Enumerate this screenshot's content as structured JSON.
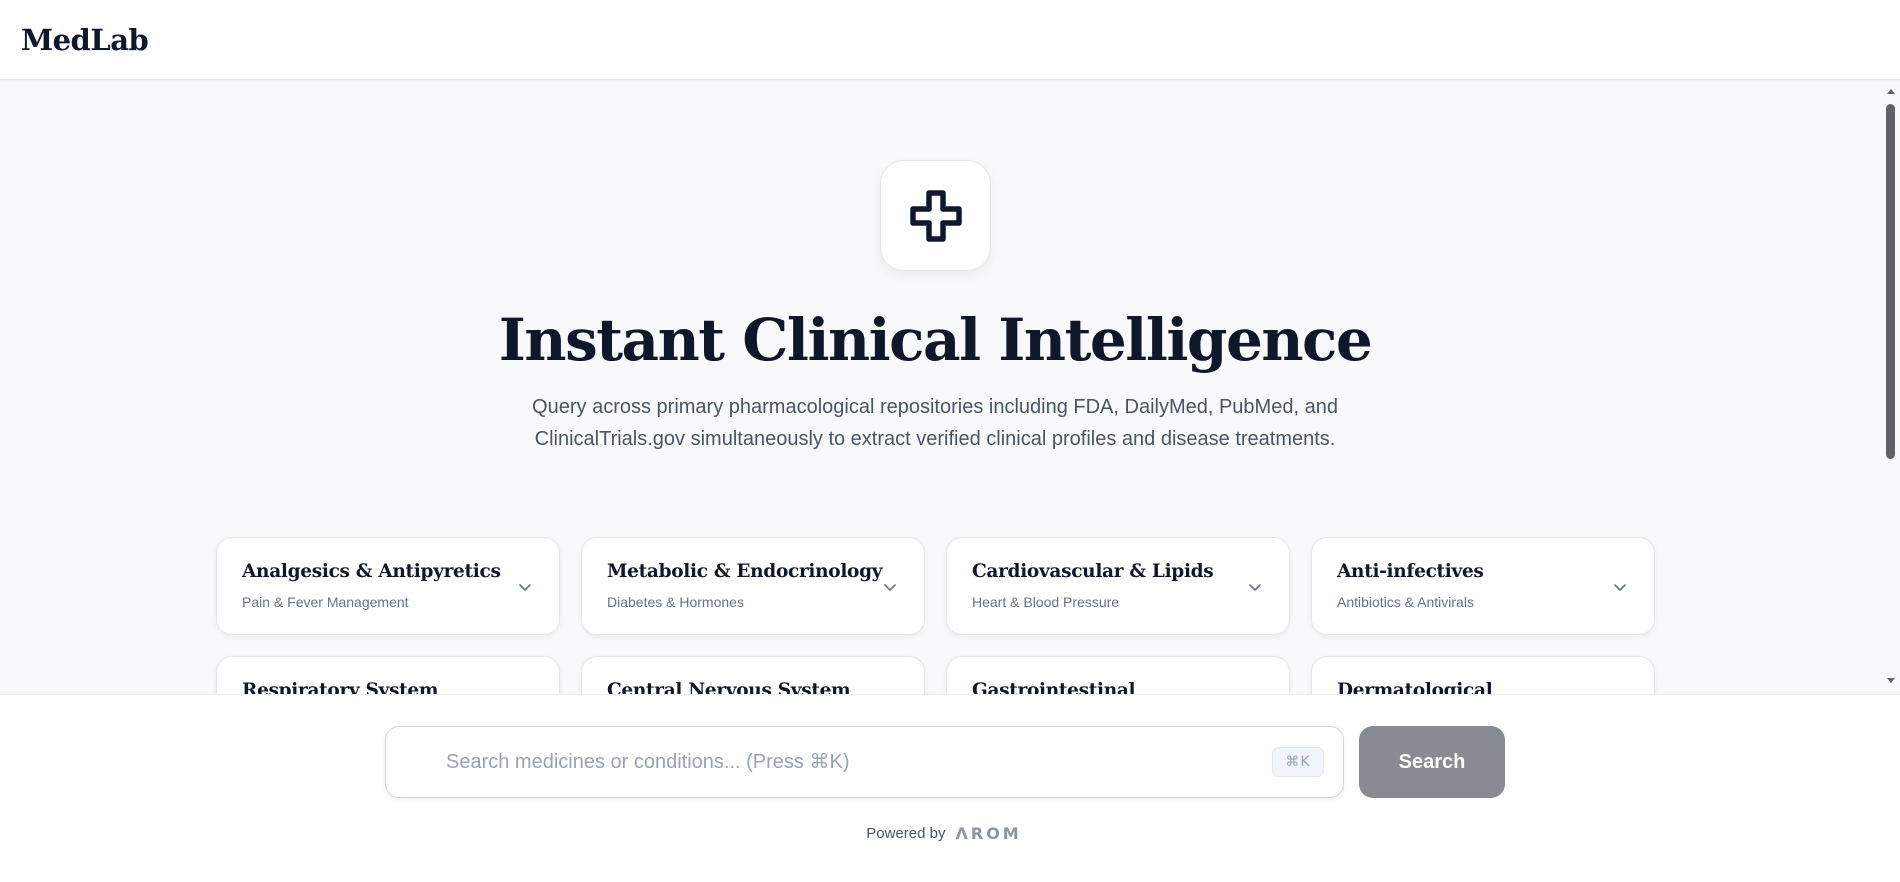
{
  "header": {
    "brand": "MedLab"
  },
  "hero": {
    "icon": "medical-cross-icon",
    "title": "Instant Clinical Intelligence",
    "subtitle_line1": "Query across primary pharmacological repositories including FDA, DailyMed, PubMed, and",
    "subtitle_line2": "ClinicalTrials.gov simultaneously to extract verified clinical profiles and disease treatments."
  },
  "categories": [
    {
      "title": "Analgesics & Antipyretics",
      "subtitle": "Pain & Fever Management"
    },
    {
      "title": "Metabolic & Endocrinology",
      "subtitle": "Diabetes & Hormones"
    },
    {
      "title": "Cardiovascular & Lipids",
      "subtitle": "Heart & Blood Pressure"
    },
    {
      "title": "Anti-infectives",
      "subtitle": "Antibiotics & Antivirals"
    },
    {
      "title": "Respiratory System",
      "subtitle": ""
    },
    {
      "title": "Central Nervous System",
      "subtitle": ""
    },
    {
      "title": "Gastrointestinal",
      "subtitle": ""
    },
    {
      "title": "Dermatological",
      "subtitle": ""
    }
  ],
  "search": {
    "placeholder": "Search medicines or conditions... (Press ⌘K)",
    "value": "",
    "shortcut_hint": "⌘K",
    "button_label": "Search"
  },
  "footer": {
    "powered_by_label": "Powered by",
    "powered_by_brand": "ΛROM"
  },
  "colors": {
    "text_primary": "#0f172a",
    "text_muted": "#64748b",
    "background": "#f8f9fa",
    "search_button": "#888b93"
  }
}
